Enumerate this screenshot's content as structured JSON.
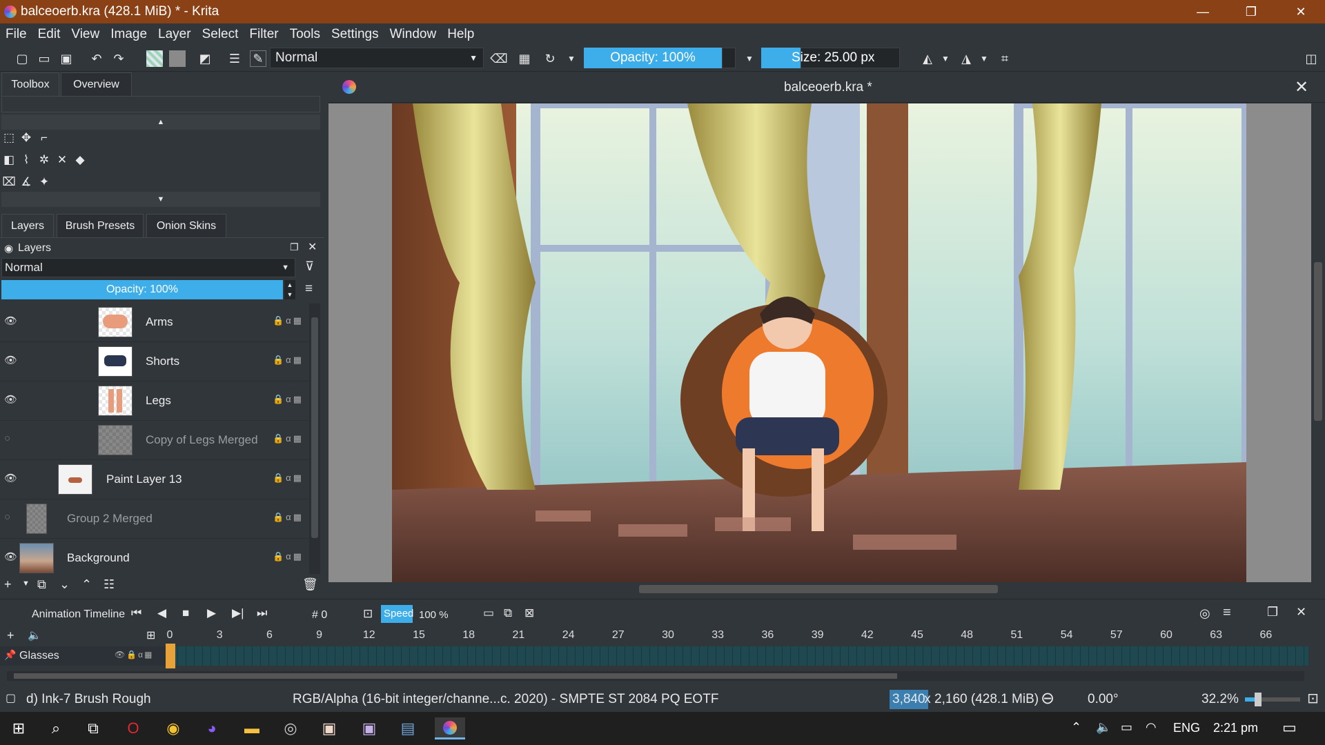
{
  "window": {
    "title": "balceoerb.kra (428.1 MiB)  * - Krita",
    "min": "—",
    "max": "❐",
    "close": "✕"
  },
  "menu": [
    "File",
    "Edit",
    "View",
    "Image",
    "Layer",
    "Select",
    "Filter",
    "Tools",
    "Settings",
    "Window",
    "Help"
  ],
  "toolbar": {
    "blend_mode": "Normal",
    "opacity": "Opacity: 100%",
    "size": "Size: 25.00 px"
  },
  "left_panel": {
    "tabs_top": [
      "Toolbox",
      "Overview"
    ],
    "tabs_mid": [
      "Layers",
      "Brush Presets",
      "Onion Skins"
    ],
    "layers_title": "Layers",
    "blend_mode": "Normal",
    "opacity": "Opacity:  100%",
    "layers": [
      {
        "name": "Arms",
        "visible": true,
        "dim": false
      },
      {
        "name": "Shorts",
        "visible": true,
        "dim": false
      },
      {
        "name": "Legs",
        "visible": true,
        "dim": false
      },
      {
        "name": "Copy of Legs Merged",
        "visible": false,
        "dim": true
      },
      {
        "name": "Paint Layer 13",
        "visible": true,
        "dim": false
      },
      {
        "name": "Group 2 Merged",
        "visible": false,
        "dim": true
      },
      {
        "name": "Background",
        "visible": true,
        "dim": false
      }
    ]
  },
  "canvas": {
    "doc_title": "balceoerb.kra *"
  },
  "animation": {
    "title": "Animation Timeline",
    "frame": "# 0",
    "speed_label": "Speed",
    "speed_value": "100 %",
    "frames": [
      "0",
      "3",
      "6",
      "9",
      "12",
      "15",
      "18",
      "21",
      "24",
      "27",
      "30",
      "33",
      "36",
      "39",
      "42",
      "45",
      "48",
      "51",
      "54",
      "57",
      "60",
      "63",
      "66"
    ],
    "track": "Glasses"
  },
  "status": {
    "brush": "d) Ink-7 Brush Rough",
    "color_info": "RGB/Alpha (16-bit integer/channe...c. 2020) - SMPTE ST 2084 PQ EOTF",
    "dim_w": "3,840",
    "dim_rest": " x 2,160 (428.1 MiB)",
    "rotation": "0.00°",
    "zoom": "32.2%"
  },
  "taskbar": {
    "lang": "ENG",
    "time": "2:21 pm"
  },
  "colors": {
    "accent": "#3daee9",
    "titlebar": "#8a4116",
    "panel": "#31363b"
  }
}
